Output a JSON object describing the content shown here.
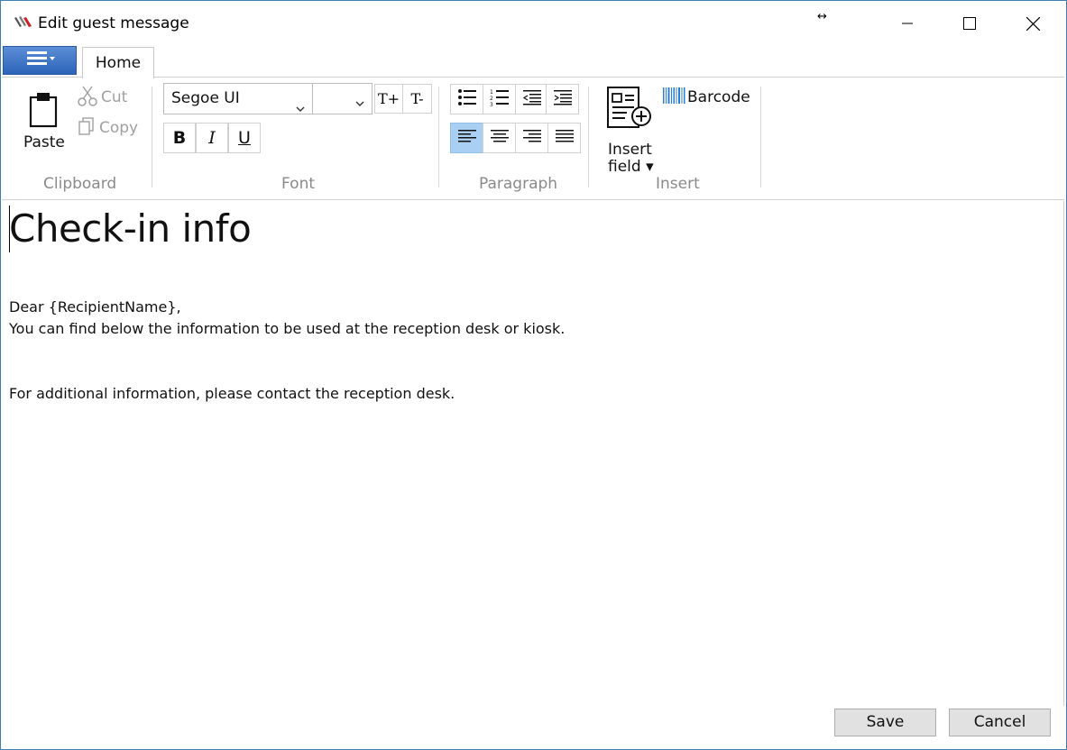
{
  "window": {
    "title": "Edit guest message",
    "resize_glyph": "↔"
  },
  "ribbon": {
    "tabs": [
      {
        "label": "Home"
      }
    ],
    "clipboard": {
      "paste_label": "Paste",
      "cut_label": "Cut",
      "copy_label": "Copy",
      "group_label": "Clipboard"
    },
    "font": {
      "font_family_value": "Segoe UI",
      "font_size_value": "",
      "grow_label": "T+",
      "shrink_label": "T-",
      "bold_label": "B",
      "italic_label": "I",
      "underline_label": "U",
      "group_label": "Font"
    },
    "paragraph": {
      "group_label": "Paragraph",
      "active_alignment": "align-left"
    },
    "insert": {
      "insert_field_line1": "Insert",
      "insert_field_line2": "field ▾",
      "barcode_label": "Barcode",
      "group_label": "Insert"
    }
  },
  "editor": {
    "heading": "Check-in info",
    "lines": [
      "Dear {RecipientName},",
      "You can find below the information to be used at the reception desk or kiosk.",
      "For additional information, please contact the reception desk."
    ]
  },
  "footer": {
    "save_label": "Save",
    "cancel_label": "Cancel"
  },
  "colors": {
    "window_border": "#3c7fb1",
    "app_menu": "#2d64b8",
    "active_paragraph_button": "#a9d0f2",
    "group_label": "#8a8a8a",
    "footer_button": "#e1e1e1"
  }
}
